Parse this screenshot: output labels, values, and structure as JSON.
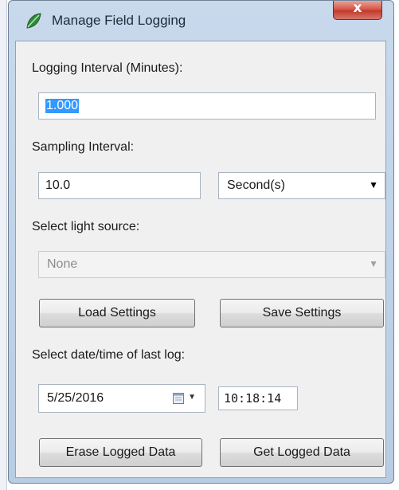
{
  "window": {
    "title": "Manage Field Logging",
    "close_glyph": "x",
    "app_icon": "leaf-icon"
  },
  "logging_interval": {
    "label": "Logging Interval (Minutes):",
    "value": "1.000"
  },
  "sampling_interval": {
    "label": "Sampling Interval:",
    "value": "10.0",
    "unit_selected": "Second(s)"
  },
  "light_source": {
    "label": "Select light source:",
    "selected": "None"
  },
  "settings_buttons": {
    "load_label": "Load Settings",
    "save_label": "Save Settings"
  },
  "last_log": {
    "label": "Select date/time of last log:",
    "date": "5/25/2016",
    "time": "10:18:14"
  },
  "data_buttons": {
    "erase_label": "Erase Logged Data",
    "get_label": "Get Logged Data"
  },
  "colors": {
    "selection": "#3399ff",
    "close_button": "#c23a2c",
    "title_bar": "#c8d9ec"
  }
}
